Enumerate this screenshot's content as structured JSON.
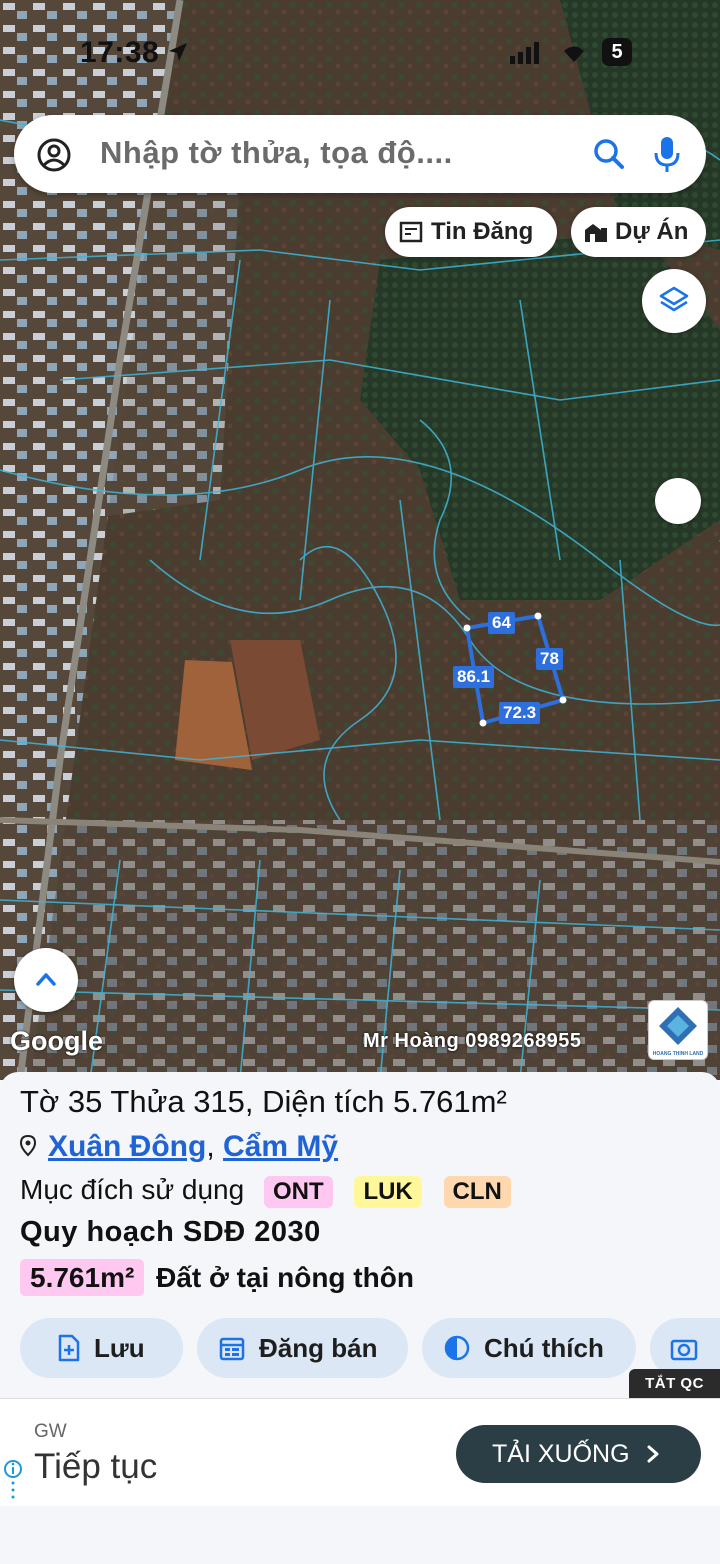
{
  "status": {
    "time": "17:38",
    "battery": "5"
  },
  "search": {
    "placeholder": "Nhập tờ thửa, tọa độ...."
  },
  "map_buttons": {
    "listings": "Tin Đăng",
    "projects": "Dự Án"
  },
  "parcel_dims": {
    "top": "64",
    "left": "86.1",
    "right": "78",
    "bottom": "72.3"
  },
  "map_footer": {
    "google": "Google",
    "owner": "Mr Hoàng 0989268955",
    "logo_text": "HOANG THINH LAND"
  },
  "parcel": {
    "title": "Tờ 35 Thửa 315, Diện tích 5.761m²",
    "ward": "Xuân Đông",
    "district": "Cẩm Mỹ",
    "usage_label": "Mục đích sử dụng",
    "usage_tags": [
      "ONT",
      "LUK",
      "CLN"
    ],
    "plan_label": "Quy hoạch SDĐ 2030",
    "plan_area": "5.761m²",
    "plan_desc": "Đất ở tại nông thôn"
  },
  "actions": {
    "save": "Lưu",
    "sell": "Đăng bán",
    "legend": "Chú thích"
  },
  "ad": {
    "close": "TẮT QC",
    "brand": "GW",
    "headline": "Tiếp tục",
    "cta": "TẢI XUỐNG"
  },
  "colors": {
    "parcel_outline": "#2d6fdc",
    "tag_ont": "#ffc8f0",
    "tag_luk": "#fff79a",
    "tag_cln": "#ffd8b0",
    "button_bg": "#dce7f6",
    "link": "#1f63d6"
  }
}
